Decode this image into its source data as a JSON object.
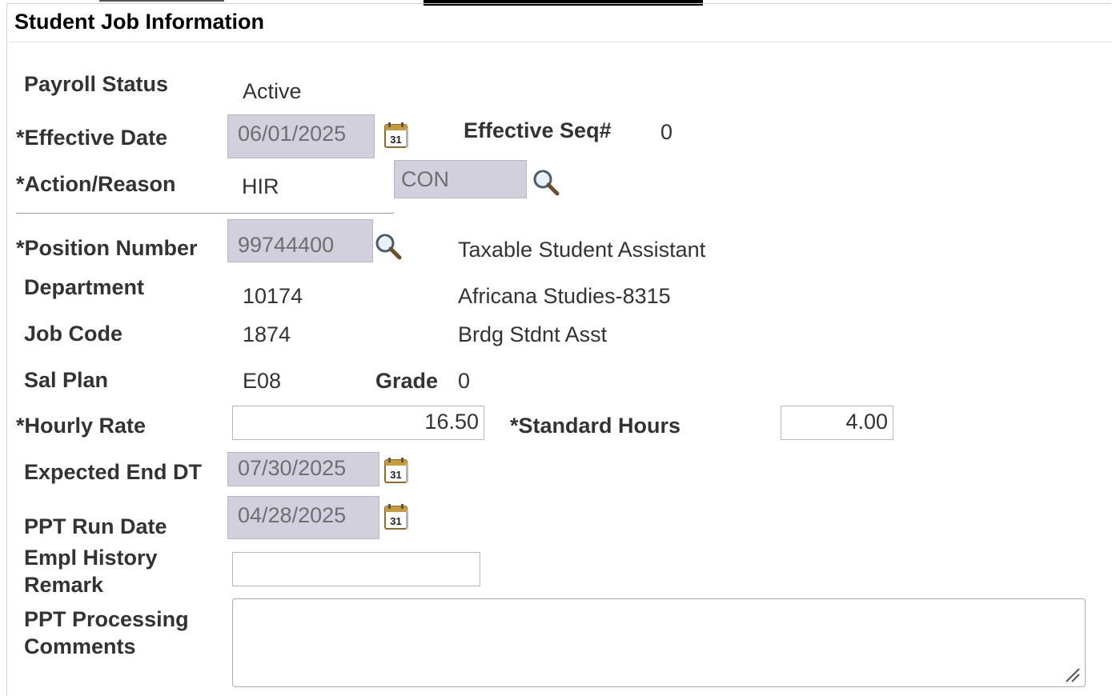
{
  "section": {
    "title": "Student Job Information"
  },
  "fields": {
    "payroll_status": {
      "label": "Payroll Status",
      "value": "Active"
    },
    "effective_date": {
      "label": "*Effective Date",
      "value": "06/01/2025"
    },
    "effective_seq": {
      "label": "Effective Seq#",
      "value": "0"
    },
    "action_reason": {
      "label": "*Action/Reason",
      "action": "HIR",
      "reason": "CON"
    },
    "position_number": {
      "label": "*Position Number",
      "value": "99744400",
      "description": "Taxable Student Assistant"
    },
    "department": {
      "label": "Department",
      "value": "10174",
      "description": "Africana Studies-8315"
    },
    "job_code": {
      "label": "Job Code",
      "value": "1874",
      "description": "Brdg Stdnt Asst"
    },
    "sal_plan": {
      "label": "Sal Plan",
      "value": "E08"
    },
    "grade": {
      "label": "Grade",
      "value": "0"
    },
    "hourly_rate": {
      "label": "*Hourly Rate",
      "value": "16.50"
    },
    "standard_hours": {
      "label": "*Standard Hours",
      "value": "4.00"
    },
    "expected_end_dt": {
      "label": "Expected End DT",
      "value": "07/30/2025"
    },
    "ppt_run_date": {
      "label": "PPT Run Date",
      "value": "04/28/2025"
    },
    "empl_history_remark": {
      "label_line1": "Empl History",
      "label_line2": "Remark",
      "value": ""
    },
    "ppt_processing_comments": {
      "label_line1": "PPT Processing",
      "label_line2": "Comments",
      "value": ""
    }
  },
  "icons": {
    "calendar": "calendar-icon",
    "lookup": "magnifier-lookup-icon",
    "resize": "resize-grip-icon"
  },
  "colors": {
    "readonly_fill": "#d3d0dd",
    "readonly_text": "#6f6f6f",
    "label_text": "#333333"
  }
}
